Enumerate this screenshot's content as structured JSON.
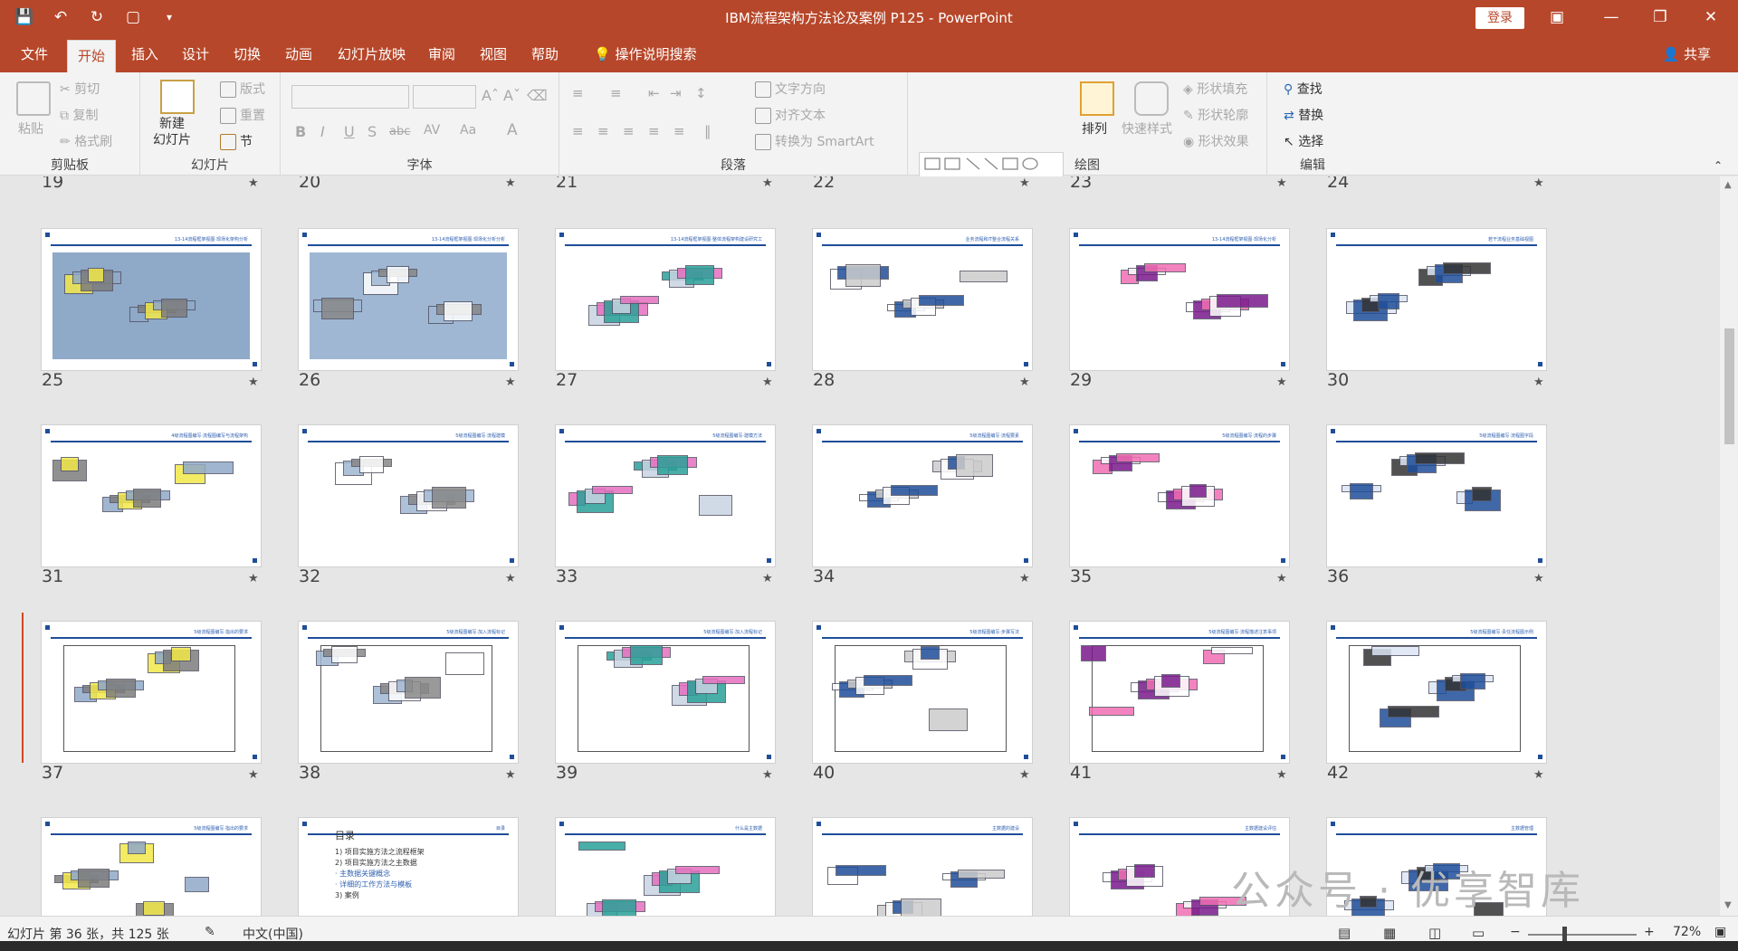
{
  "window": {
    "title": "IBM流程架构方法论及案例 P125  -  PowerPoint",
    "login_label": "登录",
    "share_label": "共享"
  },
  "menu": {
    "tabs": [
      "文件",
      "开始",
      "插入",
      "设计",
      "切换",
      "动画",
      "幻灯片放映",
      "审阅",
      "视图",
      "帮助"
    ],
    "active": "开始",
    "search_label": "操作说明搜索"
  },
  "ribbon": {
    "clipboard": {
      "label": "剪贴板",
      "paste": "粘贴",
      "cut": "剪切",
      "copy": "复制",
      "format_painter": "格式刷"
    },
    "slides": {
      "label": "幻灯片",
      "new_slide": "新建\n幻灯片",
      "layout": "版式",
      "reset": "重置",
      "section": "节"
    },
    "font": {
      "label": "字体"
    },
    "paragraph": {
      "label": "段落",
      "text_direction": "文字方向",
      "align_text": "对齐文本",
      "smartart": "转换为 SmartArt"
    },
    "drawing": {
      "label": "绘图",
      "arrange": "排列",
      "quick_styles": "快速样式",
      "shape_fill": "形状填充",
      "shape_outline": "形状轮廓",
      "shape_effects": "形状效果"
    },
    "editing": {
      "label": "编辑",
      "find": "查找",
      "replace": "替换",
      "select": "选择"
    }
  },
  "slides": [
    {
      "n": "25",
      "title": "13-14流程框架视图·现场化架构分析"
    },
    {
      "n": "26",
      "title": "13-14流程框架视图·现场化分析分析"
    },
    {
      "n": "27",
      "title": "13-14流程框架视图·整体流程架构建设研究工"
    },
    {
      "n": "28",
      "title": "业务流程和IT整合流程关系"
    },
    {
      "n": "29",
      "title": "13-14流程框架视图·现场化分析"
    },
    {
      "n": "30",
      "title": "若干流程业务基础视图"
    },
    {
      "n": "31",
      "title": "4级流程图编写·流程图编写与流程架构"
    },
    {
      "n": "32",
      "title": "5级流程图编写·流程建模"
    },
    {
      "n": "33",
      "title": "5级流程图编写·建模方法"
    },
    {
      "n": "34",
      "title": "5级流程图编写·流程要素"
    },
    {
      "n": "35",
      "title": "5级流程图编写·流程的步骤"
    },
    {
      "n": "36",
      "title": "5级流程图编写·流程图字段"
    },
    {
      "n": "37",
      "title": "5级流程图编写·指出的要求"
    },
    {
      "n": "38",
      "title": "5级流程图编写·加入流程标记"
    },
    {
      "n": "39",
      "title": "5级流程图编写·加入流程标记"
    },
    {
      "n": "40",
      "title": "5级流程图编写·步骤写法"
    },
    {
      "n": "41",
      "title": "5级流程图编写·流程描述注意事项"
    },
    {
      "n": "42",
      "title": "5级流程图编写·责任流程图示例"
    },
    {
      "n": "",
      "title": "5级流程图编写·指出的要求"
    },
    {
      "n": "",
      "title": "目录"
    },
    {
      "n": "",
      "title": "什么是主数据"
    },
    {
      "n": "",
      "title": "主数据的建设"
    },
    {
      "n": "",
      "title": "主数据建设评估"
    },
    {
      "n": "",
      "title": "主数据管理"
    }
  ],
  "row_top_numbers": [
    "19",
    "20",
    "21",
    "22",
    "23",
    "24"
  ],
  "slide38_toc": {
    "heading": "目录",
    "items": [
      "1) 项目实施方法之流程框架",
      "2) 项目实施方法之主数据",
      "· 主数据关键概念",
      "· 详细的工作方法与模板",
      "3) 案例"
    ]
  },
  "status": {
    "slide_info": "幻灯片 第 36 张，共 125 张",
    "language": "中文(中国)",
    "zoom": "72%"
  },
  "watermark": "公众号 · 优享智库",
  "colors": {
    "accent": "#b7472a",
    "slide_header": "#1f4e99"
  }
}
